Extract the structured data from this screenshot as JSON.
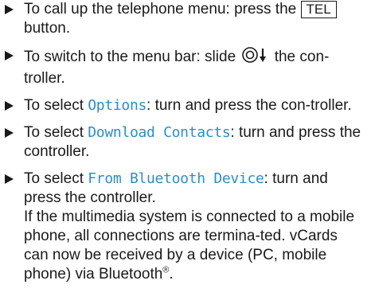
{
  "steps": [
    {
      "before": "To call up the telephone menu: press the",
      "key_label": "TEL",
      "after": "button."
    },
    {
      "before": "To switch to the menu bar: slide",
      "icon": "controller-slide-down-icon",
      "after": "the con-troller."
    },
    {
      "before": "To select",
      "menu_item": "Options",
      "after": ": turn and press the con-troller."
    },
    {
      "before": "To select",
      "menu_item": "Download Contacts",
      "after": ": turn and press the controller."
    },
    {
      "before": "To select",
      "menu_item": "From Bluetooth Device",
      "after": ": turn and press the controller.",
      "note": "If the multimedia system is connected to a mobile phone, all connections are termina-ted. vCards can now be received by a device (PC, mobile phone) via Bluetooth",
      "note_suffix": "®",
      "note_end": "."
    }
  ],
  "colors": {
    "menu_item": "#2b8fc4",
    "text": "#1a1a1a"
  }
}
